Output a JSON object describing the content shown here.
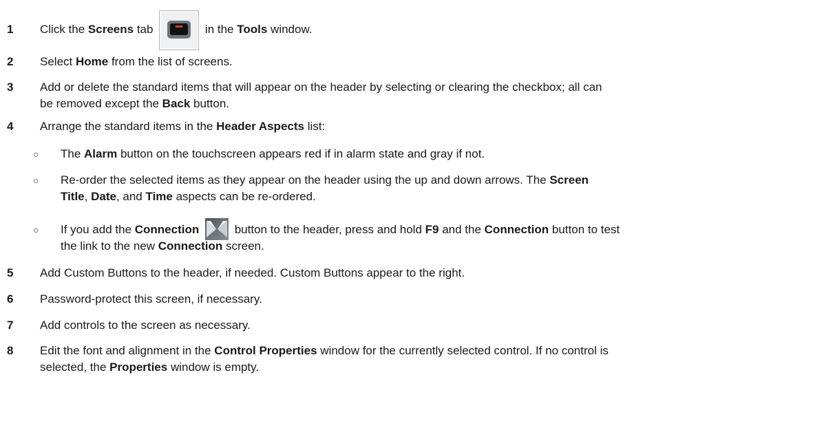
{
  "steps": [
    {
      "num": "1",
      "parts": [
        "Click the ",
        "Screens",
        " tab ",
        " in the ",
        "Tools",
        " window."
      ]
    },
    {
      "num": "2",
      "parts": [
        "Select ",
        "Home",
        " from the list of screens."
      ]
    },
    {
      "num": "3",
      "line1": [
        "Add or delete the standard items that will appear on the header by selecting or clearing the checkbox; all can"
      ],
      "line2": [
        "be removed except the ",
        "Back",
        " button."
      ]
    },
    {
      "num": "4",
      "parts": [
        "Arrange the standard items in the ",
        "Header Aspects",
        " list:"
      ]
    },
    {
      "num": "5",
      "parts": [
        "Add Custom Buttons to the header, if needed. Custom Buttons appear to the right."
      ]
    },
    {
      "num": "6",
      "parts": [
        "Password-protect this screen, if necessary."
      ]
    },
    {
      "num": "7",
      "parts": [
        "Add controls to the screen as necessary."
      ]
    },
    {
      "num": "8",
      "line1": [
        "Edit the font and alignment in the ",
        "Control Properties",
        " window for the currently selected control. If no control is"
      ],
      "line2": [
        "selected, the ",
        "Properties",
        " window is empty."
      ]
    }
  ],
  "bullet_glyph": "○",
  "sub_bullets": [
    {
      "line1": [
        "The ",
        "Alarm",
        " button on the touchscreen appears red if in alarm state and gray if not."
      ]
    },
    {
      "line1": [
        "Re-order the selected items as they appear on the header using the up and down arrows. The ",
        "Screen"
      ],
      "line2": [
        "Title",
        ", ",
        "Date",
        ", and ",
        "Time",
        " aspects can be re-ordered."
      ]
    },
    {
      "line1": [
        "If you add the ",
        "Connection",
        " ",
        " button to the header, press and hold ",
        "F9",
        " and the ",
        "Connection",
        " button to test"
      ],
      "line2": [
        "the link to the new ",
        "Connection",
        " screen."
      ]
    }
  ],
  "icons": {
    "screens_tab": "monitor-icon",
    "connection": "connection-icon"
  },
  "colors": {
    "text": "#1a1a1a",
    "icon_accent_red": "#d93a30"
  }
}
